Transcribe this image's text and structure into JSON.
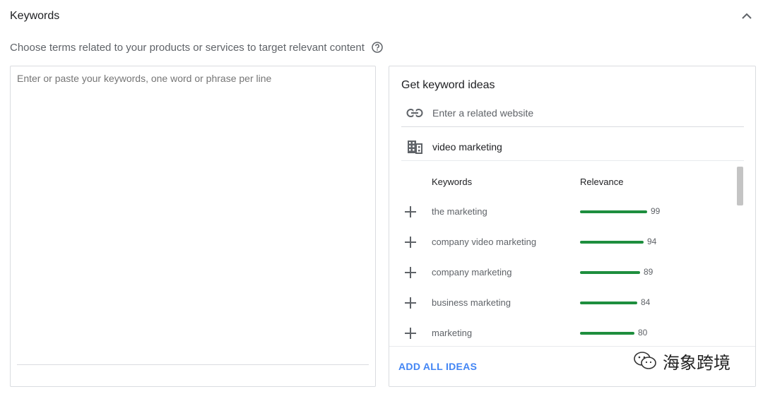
{
  "section": {
    "title": "Keywords",
    "subtitle": "Choose terms related to your products or services to target relevant content"
  },
  "keywords_input": {
    "placeholder": "Enter or paste your keywords, one word or phrase per line",
    "value": ""
  },
  "ideas": {
    "title": "Get keyword ideas",
    "website_placeholder": "Enter a related website",
    "product_value": "video marketing",
    "columns": {
      "keywords": "Keywords",
      "relevance": "Relevance"
    },
    "items": [
      {
        "keyword": "the marketing",
        "relevance": 99
      },
      {
        "keyword": "company video marketing",
        "relevance": 94
      },
      {
        "keyword": "company marketing",
        "relevance": 89
      },
      {
        "keyword": "business marketing",
        "relevance": 84
      },
      {
        "keyword": "marketing",
        "relevance": 80
      }
    ],
    "add_all_label": "ADD ALL IDEAS"
  },
  "watermark": {
    "text": "海象跨境"
  },
  "colors": {
    "relevance_bar": "#1e8e3e",
    "action": "#4285f4"
  },
  "icons": {
    "collapse": "chevron-up-icon",
    "help": "help-circle-icon",
    "website": "link-icon",
    "product": "building-icon",
    "add": "plus-icon"
  }
}
